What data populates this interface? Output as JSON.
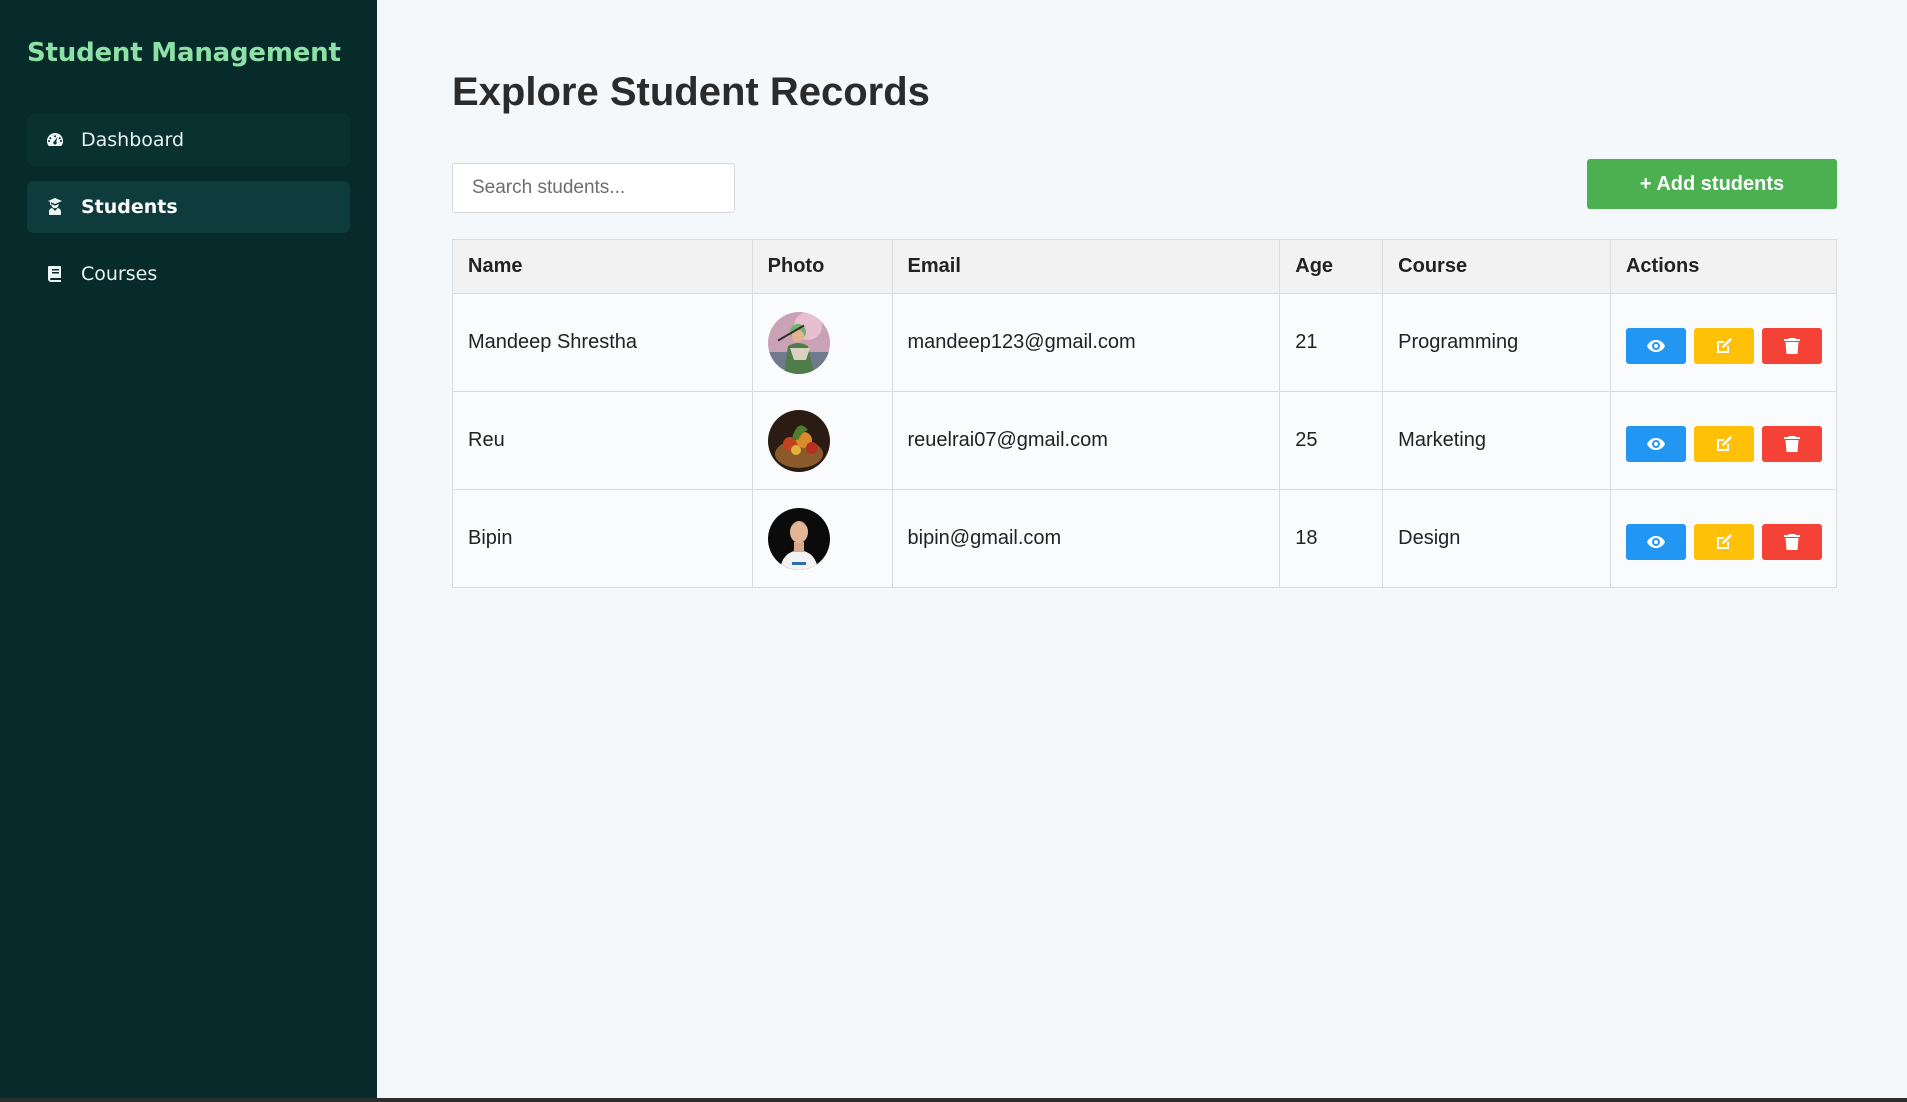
{
  "sidebar": {
    "brand": "Student Management",
    "items": [
      {
        "label": "Dashboard",
        "icon": "dashboard-gauge-icon",
        "active": false
      },
      {
        "label": "Students",
        "icon": "student-icon",
        "active": true
      },
      {
        "label": "Courses",
        "icon": "book-icon",
        "active": false
      }
    ]
  },
  "main": {
    "title": "Explore Student Records",
    "search_placeholder": "Search students...",
    "add_button": "+ Add students",
    "table": {
      "headers": [
        "Name",
        "Photo",
        "Email",
        "Age",
        "Course",
        "Actions"
      ],
      "rows": [
        {
          "name": "Mandeep Shrestha",
          "photo": "avatar-character",
          "email": "mandeep123@gmail.com",
          "age": "21",
          "course": "Programming"
        },
        {
          "name": "Reu",
          "photo": "avatar-vegetable-basket",
          "email": "reuelrai07@gmail.com",
          "age": "25",
          "course": "Marketing"
        },
        {
          "name": "Bipin",
          "photo": "avatar-person",
          "email": "bipin@gmail.com",
          "age": "18",
          "course": "Design"
        }
      ]
    },
    "actions": {
      "view": "eye-icon",
      "edit": "edit-icon",
      "delete": "trash-icon"
    }
  },
  "colors": {
    "sidebar_bg": "#072b2b",
    "brand": "#8de0a6",
    "add_button": "#4cb050",
    "view": "#2196f3",
    "edit": "#ffc107",
    "delete": "#f44336"
  }
}
